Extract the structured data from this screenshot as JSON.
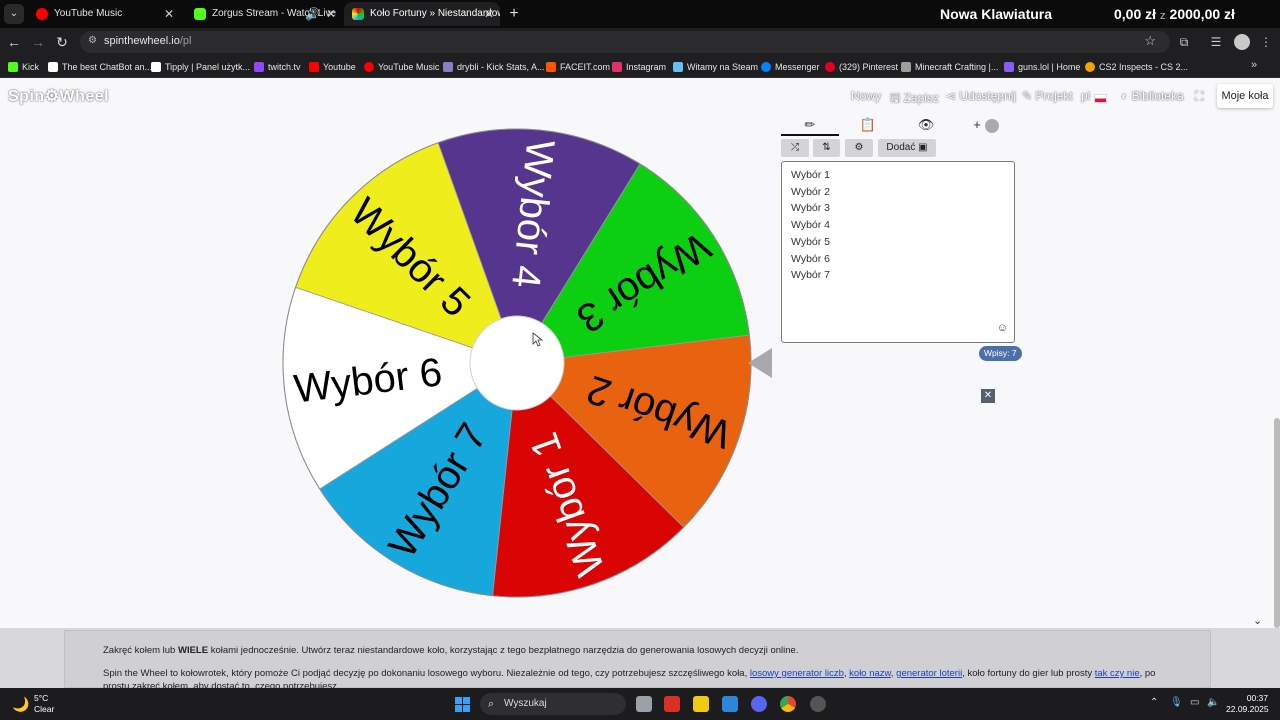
{
  "browser": {
    "tabs": [
      {
        "title": "YouTube Music",
        "active": false,
        "color": "#ff0000"
      },
      {
        "title": "Zorgus Stream - Watch Live",
        "active": false,
        "color": "#53fc18"
      },
      {
        "title": "Koło Fortuny » Niestandardowe",
        "active": true,
        "color": "#e84393"
      }
    ],
    "new_tab": "+",
    "promo": {
      "title": "Nowa Klawiatura",
      "current": "0,00 zł",
      "sep": "z",
      "goal": "2000,00 zł"
    },
    "address": {
      "host": "spinthewheel.io",
      "path": "/pl"
    },
    "bookmarks": [
      {
        "label": "Kick",
        "color": "#53fc18"
      },
      {
        "label": "The best ChatBot an...",
        "color": "#ffffff"
      },
      {
        "label": "Tipply | Panel użytk...",
        "color": "#ffffff"
      },
      {
        "label": "twitch.tv",
        "color": "#9146ff"
      },
      {
        "label": "Youtube",
        "color": "#ff0000"
      },
      {
        "label": "YouTube Music",
        "color": "#ff0000"
      },
      {
        "label": "drybli - Kick Stats, A...",
        "color": "#8e7cc3"
      },
      {
        "label": "FACEIT.com",
        "color": "#ff5500"
      },
      {
        "label": "Instagram",
        "color": "#e1306c"
      },
      {
        "label": "Witamy na Steam",
        "color": "#66c0f4"
      },
      {
        "label": "Messenger",
        "color": "#0084ff"
      },
      {
        "label": "(329) Pinterest",
        "color": "#e60023"
      },
      {
        "label": "Minecraft Crafting |...",
        "color": "#9e9e9e"
      },
      {
        "label": "guns.lol | Home",
        "color": "#8a5cf6"
      },
      {
        "label": "CS2 Inspects - CS 2...",
        "color": "#f0a500"
      }
    ]
  },
  "site": {
    "logo": "Spin⚙Wheel",
    "menu": {
      "new": "Nowy",
      "save": "Zapisz",
      "share": "Udostępnij",
      "design": "Projekt",
      "lang": "pl",
      "library": "Biblioteka",
      "my_wheels": "Moje koła"
    }
  },
  "wheel": {
    "segments": [
      {
        "label": "Wybór 1",
        "color": "#d90404",
        "text_color": "#ffffff"
      },
      {
        "label": "Wybór 2",
        "color": "#e8620f",
        "text_color": "#000000"
      },
      {
        "label": "Wybór 3",
        "color": "#0ccf12",
        "text_color": "#000000"
      },
      {
        "label": "Wybór 4",
        "color": "#56358f",
        "text_color": "#ffffff"
      },
      {
        "label": "Wybór 5",
        "color": "#f0ed1c",
        "text_color": "#000000"
      },
      {
        "label": "Wybór 6",
        "color": "#ffffff",
        "text_color": "#000000"
      },
      {
        "label": "Wybór 7",
        "color": "#16a8dc",
        "text_color": "#000000"
      }
    ]
  },
  "panel": {
    "tabs": [
      "pencil-icon",
      "clipboard-icon",
      "eye-slash-icon",
      "add-image-icon"
    ],
    "tools": {
      "shuffle": "⤮",
      "sort": "⇅",
      "settings": "⚙",
      "add_label": "Dodać"
    },
    "entries": [
      "Wybór 1",
      "Wybór 2",
      "Wybór 3",
      "Wybór 4",
      "Wybór 5",
      "Wybór 6",
      "Wybór 7"
    ],
    "count_label": "Wpisy: 7",
    "close": "✕"
  },
  "info": {
    "p1_a": "Zakręć kołem lub ",
    "p1_b": "WIELE",
    "p1_c": " kołami jednocześnie. Utwórz teraz niestandardowe koło, korzystając z tego bezpłatnego narzędzia do generowania losowych decyzji online.",
    "p2_a": "Spin the Wheel to kołowrotek, który pomoże Ci podjąć decyzję po dokonaniu losowego wyboru. Niezależnie od tego, czy potrzebujesz szczęśliwego koła, ",
    "link1": "losowy generator liczb",
    "sep1": ", ",
    "link2": "koło nazw",
    "sep2": ", ",
    "link3": "generator loterii",
    "p2_b": ", koło fortuny do gier lub prosty ",
    "link4": "tak czy nie",
    "p2_c": ", po prostu zakręć kołem, aby dostać to, czego potrzebujesz."
  },
  "taskbar": {
    "temp": "5°C",
    "weather": "Clear",
    "search": "Wyszukaj",
    "time": "00:37",
    "date": "22.09.2025"
  }
}
